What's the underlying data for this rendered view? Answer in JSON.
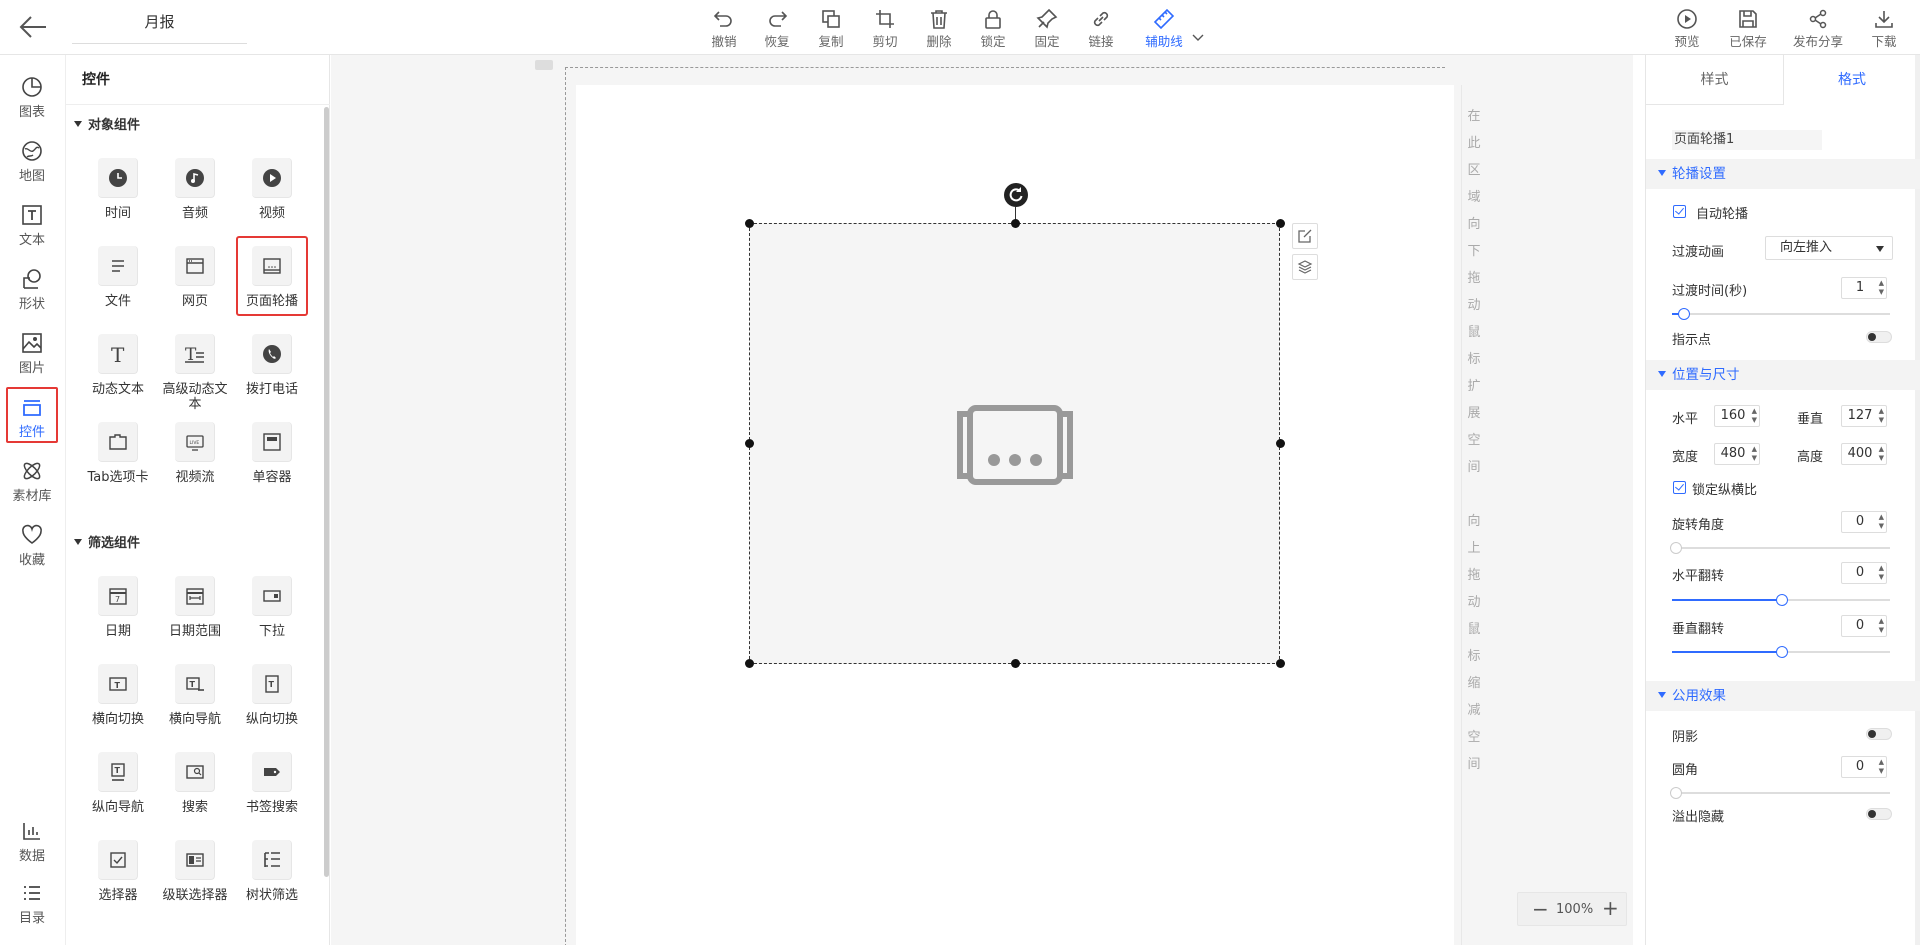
{
  "doc_title": "月报",
  "toolbar": {
    "items": [
      {
        "label": "撤销",
        "icon": "undo-icon"
      },
      {
        "label": "恢复",
        "icon": "redo-icon"
      },
      {
        "label": "复制",
        "icon": "copy-icon"
      },
      {
        "label": "剪切",
        "icon": "crop-icon"
      },
      {
        "label": "删除",
        "icon": "trash-icon"
      },
      {
        "label": "锁定",
        "icon": "lock-icon"
      },
      {
        "label": "固定",
        "icon": "pin-icon"
      },
      {
        "label": "链接",
        "icon": "link-icon"
      },
      {
        "label": "辅助线",
        "icon": "ruler-icon"
      }
    ],
    "right": [
      {
        "label": "预览",
        "icon": "play-icon"
      },
      {
        "label": "已保存",
        "icon": "save-icon"
      },
      {
        "label": "发布分享",
        "icon": "share-icon"
      },
      {
        "label": "下载",
        "icon": "download-icon"
      }
    ]
  },
  "rail": {
    "items": [
      {
        "label": "图表",
        "icon": "pie-chart-icon"
      },
      {
        "label": "地图",
        "icon": "map-icon"
      },
      {
        "label": "文本",
        "icon": "text-icon"
      },
      {
        "label": "形状",
        "icon": "shape-icon"
      },
      {
        "label": "图片",
        "icon": "image-icon"
      },
      {
        "label": "控件",
        "icon": "widget-icon"
      },
      {
        "label": "素材库",
        "icon": "atom-icon"
      },
      {
        "label": "收藏",
        "icon": "heart-icon"
      }
    ],
    "bottom": [
      {
        "label": "数据",
        "icon": "bar-chart-icon"
      },
      {
        "label": "目录",
        "icon": "list-icon"
      }
    ]
  },
  "panel": {
    "title": "控件",
    "sections": [
      {
        "title": "对象组件",
        "items": [
          "时间",
          "音频",
          "视频",
          "文件",
          "网页",
          "页面轮播",
          "动态文本",
          "高级动态文本",
          "拨打电话",
          "Tab选项卡",
          "视频流",
          "单容器"
        ]
      },
      {
        "title": "筛选组件",
        "items": [
          "日期",
          "日期范围",
          "下拉",
          "横向切换",
          "横向导航",
          "纵向切换",
          "纵向导航",
          "搜索",
          "书签搜索",
          "选择器",
          "级联选择器",
          "树状筛选"
        ]
      }
    ]
  },
  "canvas": {
    "side_text_1": [
      "在",
      "此",
      "区",
      "域",
      "向",
      "下",
      "拖",
      "动",
      "鼠",
      "标",
      "扩",
      "展",
      "空",
      "间"
    ],
    "side_text_2": [
      "向",
      "上",
      "拖",
      "动",
      "鼠",
      "标",
      "缩",
      "减",
      "空",
      "间"
    ],
    "zoom": "100%"
  },
  "props": {
    "tabs": [
      "样式",
      "格式"
    ],
    "component_name": "页面轮播1",
    "carousel": {
      "title": "轮播设置",
      "auto_label": "自动轮播",
      "transition_label": "过渡动画",
      "transition_value": "向左推入",
      "duration_label": "过渡时间(秒)",
      "duration_value": "1",
      "indicator_label": "指示点"
    },
    "position": {
      "title": "位置与尺寸",
      "h_label": "水平",
      "h_value": "160",
      "v_label": "垂直",
      "v_value": "127",
      "w_label": "宽度",
      "w_value": "480",
      "ht_label": "高度",
      "ht_value": "400",
      "lock_label": "锁定纵横比",
      "rot_label": "旋转角度",
      "rot_value": "0",
      "hflip_label": "水平翻转",
      "hflip_value": "0",
      "vflip_label": "垂直翻转",
      "vflip_value": "0"
    },
    "effects": {
      "title": "公用效果",
      "shadow_label": "阴影",
      "radius_label": "圆角",
      "radius_value": "0",
      "overflow_label": "溢出隐藏"
    }
  },
  "colors": {
    "accent": "#2f6bff",
    "highlight": "#e53935"
  }
}
